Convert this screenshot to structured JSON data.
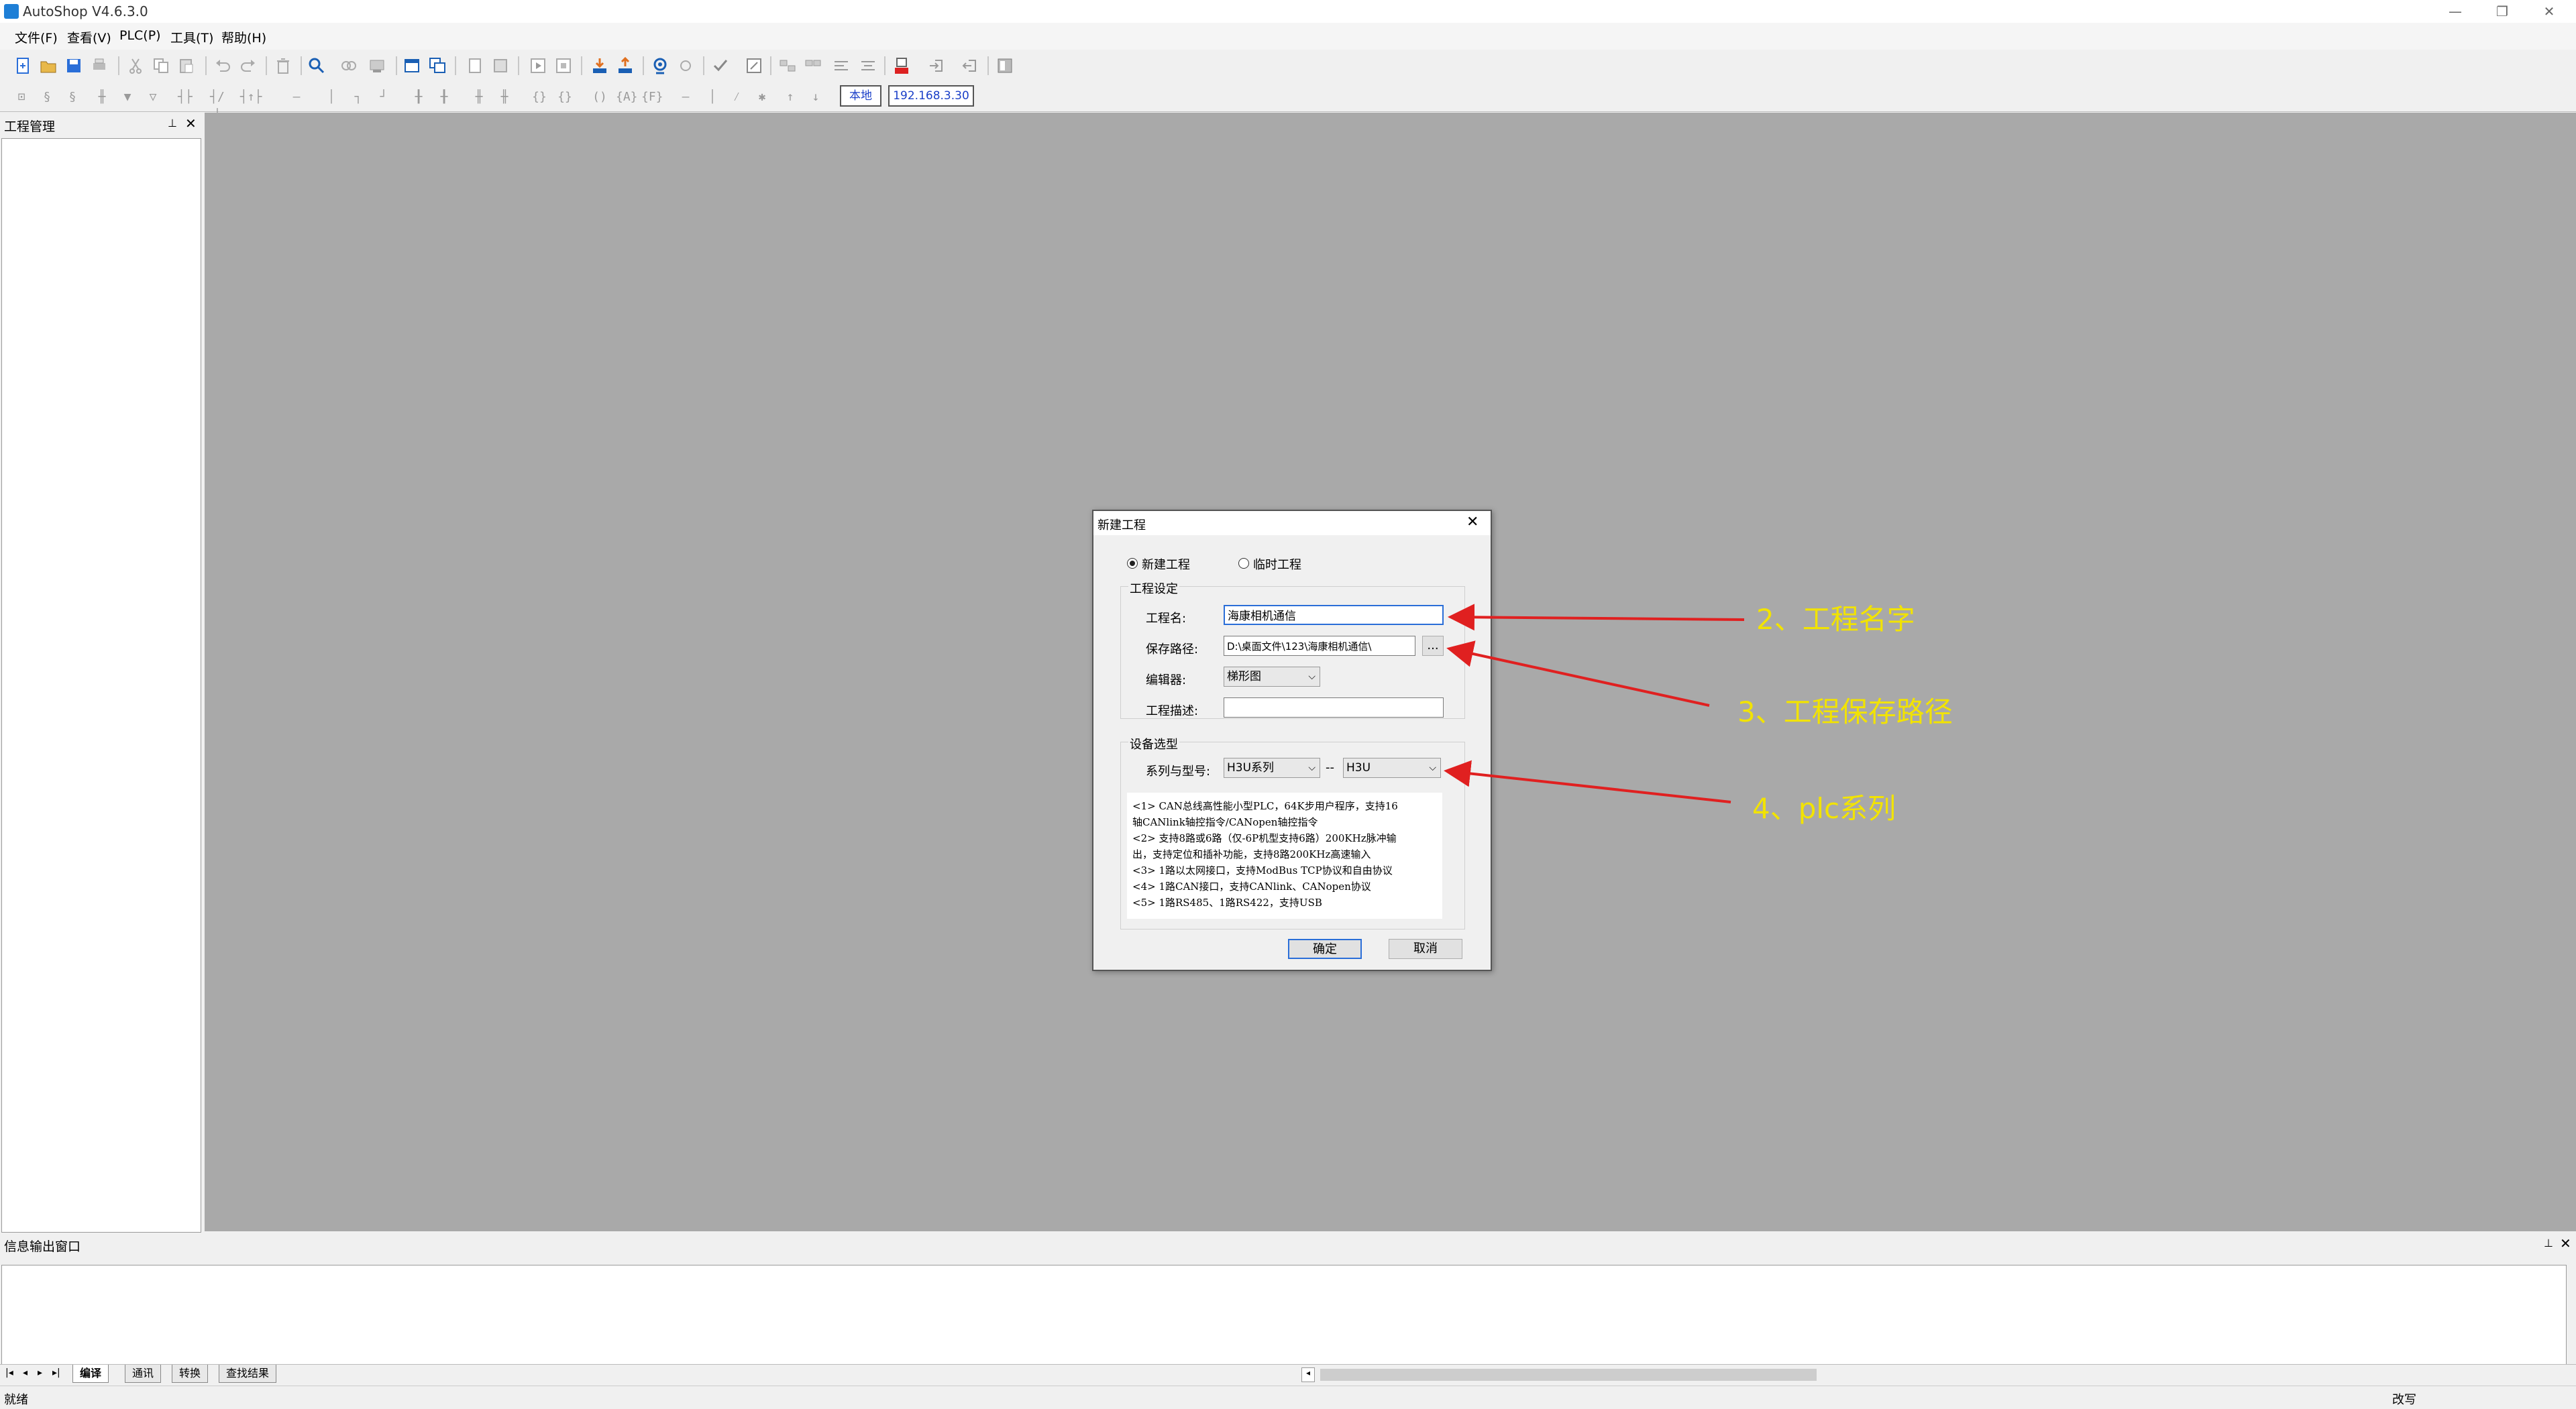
{
  "app": {
    "title": "AutoShop V4.6.3.0"
  },
  "menu": [
    "文件(F)",
    "查看(V)",
    "PLC(P)",
    "工具(T)",
    "帮助(H)"
  ],
  "toolbar2": {
    "local_label": "本地",
    "ip": "192.168.3.30"
  },
  "panels": {
    "project": "工程管理",
    "output": "信息输出窗口"
  },
  "output_tabs": [
    "编译",
    "通讯",
    "转换",
    "查找结果"
  ],
  "status": {
    "left": "就绪",
    "right": "改写"
  },
  "dialog": {
    "title": "新建工程",
    "radio_new": "新建工程",
    "radio_temp": "临时工程",
    "group_settings": "工程设定",
    "name_label": "工程名:",
    "name_value": "海康相机通信",
    "path_label": "保存路径:",
    "path_value": "D:\\桌面文件\\123\\海康相机通信\\",
    "browse": "...",
    "editor_label": "编辑器:",
    "editor_value": "梯形图",
    "desc_label": "工程描述:",
    "desc_value": "",
    "group_device": "设备选型",
    "series_label": "系列与型号:",
    "series_value": "H3U系列",
    "series_sep": "--",
    "model_value": "H3U",
    "description_lines": [
      "<1> CAN总线高性能小型PLC，64K步用户程序，支持16",
      "轴CANlink轴控指令/CANopen轴控指令",
      "<2> 支持8路或6路（仅-6P机型支持6路）200KHz脉冲输",
      "出，支持定位和插补功能，支持8路200KHz高速输入",
      "<3> 1路以太网接口，支持ModBus TCP协议和自由协议",
      "<4> 1路CAN接口，支持CANlink、CANopen协议",
      "<5> 1路RS485、1路RS422，支持USB"
    ],
    "ok": "确定",
    "cancel": "取消"
  },
  "annotations": [
    "2、工程名字",
    "3、工程保存路径",
    "4、plc系列"
  ],
  "colors": {
    "annotation_text": "#f2e300",
    "arrow": "#e02020",
    "workspace": "#a9a9a9",
    "focus": "#2a6ed8"
  }
}
